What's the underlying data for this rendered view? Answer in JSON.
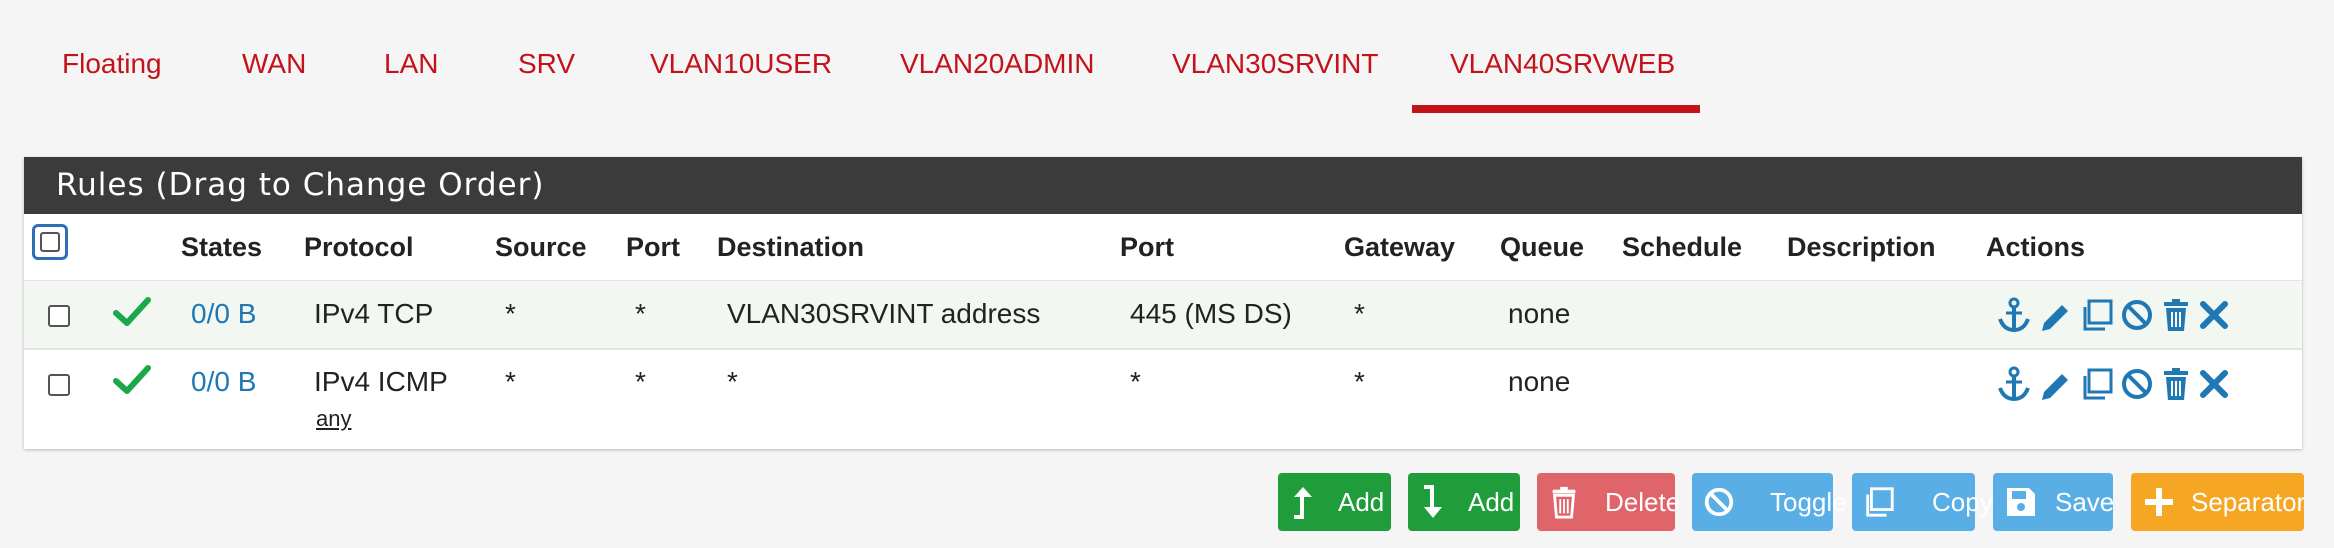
{
  "tabs": [
    {
      "label": "Floating"
    },
    {
      "label": "WAN"
    },
    {
      "label": "LAN"
    },
    {
      "label": "SRV"
    },
    {
      "label": "VLAN10USER"
    },
    {
      "label": "VLAN20ADMIN"
    },
    {
      "label": "VLAN30SRVINT"
    },
    {
      "label": "VLAN40SRVWEB",
      "active": true
    }
  ],
  "panel": {
    "title": "Rules (Drag to Change Order)"
  },
  "columns": {
    "states": "States",
    "protocol": "Protocol",
    "source": "Source",
    "port": "Port",
    "destination": "Destination",
    "dest_port": "Port",
    "gateway": "Gateway",
    "queue": "Queue",
    "schedule": "Schedule",
    "description": "Description",
    "actions": "Actions"
  },
  "rules": [
    {
      "states": "0/0 B",
      "protocol": "IPv4 TCP",
      "protocol_sub": "",
      "source": "*",
      "port": "*",
      "destination": "VLAN30SRVINT address",
      "dest_port": "445 (MS DS)",
      "gateway": "*",
      "queue": "none",
      "schedule": "",
      "description": "",
      "status_icon": "check-icon"
    },
    {
      "states": "0/0 B",
      "protocol": "IPv4 ICMP",
      "protocol_sub": "any",
      "source": "*",
      "port": "*",
      "destination": "*",
      "dest_port": "*",
      "gateway": "*",
      "queue": "none",
      "schedule": "",
      "description": "",
      "status_icon": "check-icon"
    }
  ],
  "row_actions": [
    "anchor-icon",
    "pencil-icon",
    "copy-icon",
    "ban-icon",
    "trash-icon",
    "times-icon"
  ],
  "buttons": {
    "add_top": "Add",
    "add_bottom": "Add",
    "delete": "Delete",
    "toggle": "Toggle",
    "copy": "Copy",
    "save": "Save",
    "separator": "Separator"
  },
  "colors": {
    "accent_red": "#c4121b",
    "heading_bg": "#3b3b3b",
    "link_blue": "#1f77b4",
    "success_green": "#1aa84b",
    "btn_green": "#1f9d3a",
    "btn_red": "#e0656b",
    "btn_blue": "#5aaee6",
    "btn_orange": "#f5a623"
  }
}
